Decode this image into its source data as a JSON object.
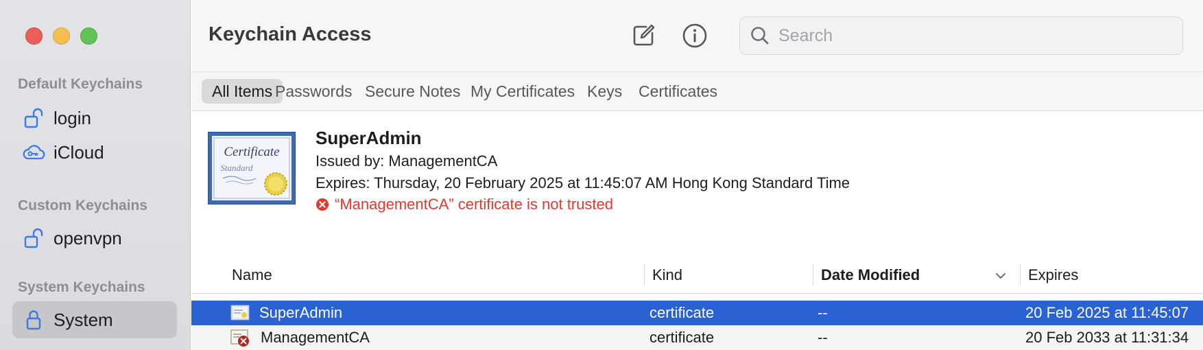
{
  "sidebar": {
    "groups": [
      {
        "header": "Default Keychains",
        "items": [
          {
            "label": "login",
            "icon": "unlocked-padlock-icon"
          },
          {
            "label": "iCloud",
            "icon": "icloud-key-icon"
          }
        ]
      },
      {
        "header": "Custom Keychains",
        "items": [
          {
            "label": "openvpn",
            "icon": "unlocked-padlock-icon"
          }
        ]
      },
      {
        "header": "System Keychains",
        "items": [
          {
            "label": "System",
            "icon": "locked-padlock-icon",
            "selected": true
          }
        ]
      }
    ]
  },
  "toolbar": {
    "title": "Keychain Access",
    "compose_icon": "compose-icon",
    "info_icon": "info-icon",
    "search_placeholder": "Search"
  },
  "tabs": [
    "All Items",
    "Passwords",
    "Secure Notes",
    "My Certificates",
    "Keys",
    "Certificates"
  ],
  "detail": {
    "name": "SuperAdmin",
    "issued_by": "Issued by: ManagementCA",
    "expires": "Expires: Thursday, 20 February 2025 at 11:45:07 AM Hong Kong Standard Time",
    "warning": "“ManagementCA” certificate is not trusted"
  },
  "table": {
    "columns": [
      "Name",
      "Kind",
      "Date Modified",
      "Expires"
    ],
    "rows": [
      {
        "name": "SuperAdmin",
        "kind": "certificate",
        "date_modified": "--",
        "expires": "20 Feb 2025 at 11:45:07",
        "selected": true
      },
      {
        "name": "ManagementCA",
        "kind": "certificate",
        "date_modified": "--",
        "expires": "20 Feb 2033 at 11:31:34",
        "selected": false
      }
    ]
  },
  "colors": {
    "accent": "#2a61d3",
    "warning": "#e0392f",
    "icon_blue": "#3b7ae0"
  }
}
